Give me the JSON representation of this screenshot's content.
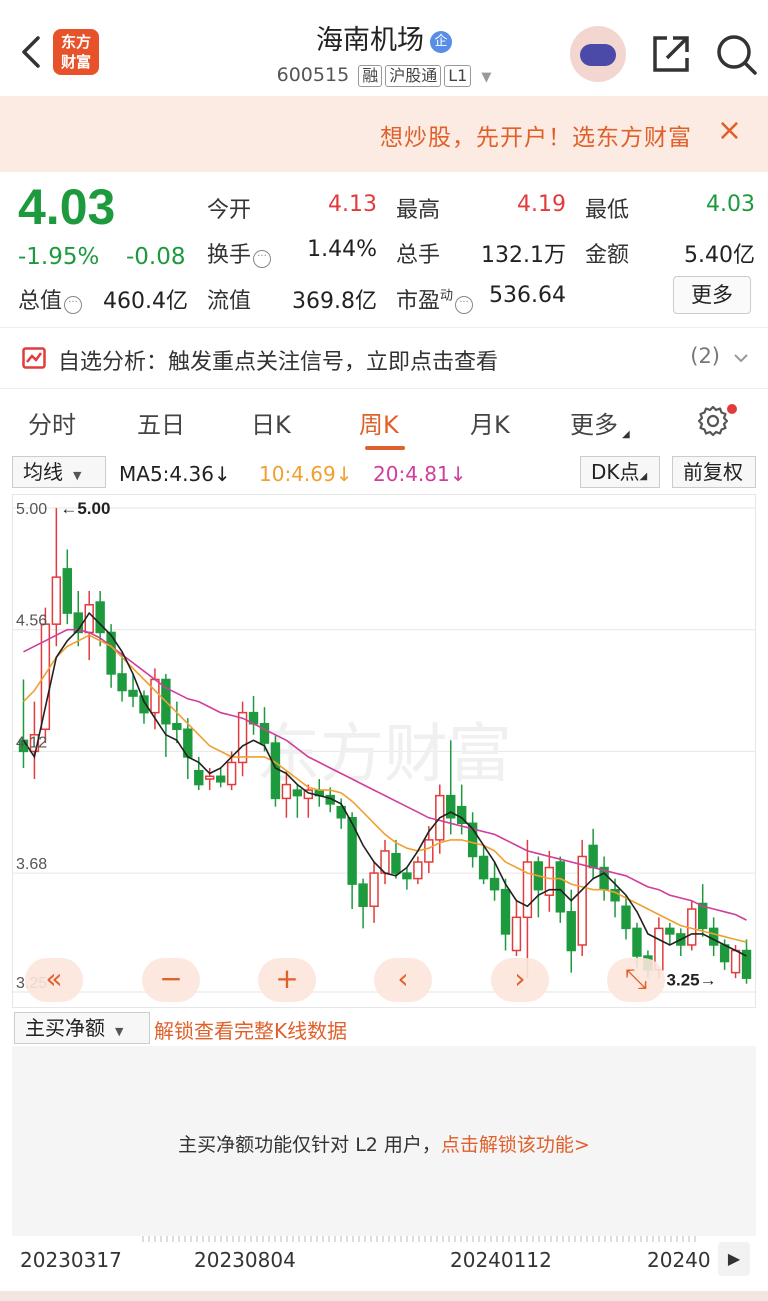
{
  "header": {
    "logo_line1": "东方",
    "logo_line2": "财富",
    "title": "海南机场",
    "title_badge": "企",
    "code": "600515",
    "tags": [
      "融",
      "沪股通",
      "L1"
    ],
    "icons": [
      "back-arrow-icon",
      "robot-avatar-icon",
      "share-icon",
      "search-icon"
    ]
  },
  "promo": {
    "text": "想炒股，先开户！选东方财富",
    "close": "×"
  },
  "quote": {
    "price": "4.03",
    "change_pct": "-1.95%",
    "change": "-0.08",
    "rows": [
      [
        {
          "label": "今开",
          "value": "4.13",
          "color": "#e23b3b"
        },
        {
          "label": "最高",
          "value": "4.19",
          "color": "#e23b3b"
        },
        {
          "label": "最低",
          "value": "4.03",
          "color": "#1e9a3e"
        }
      ],
      [
        {
          "label": "换手",
          "value": "1.44%",
          "color": "#222222"
        },
        {
          "label": "总手",
          "value": "132.1万",
          "color": "#222222"
        },
        {
          "label": "金额",
          "value": "5.40亿",
          "color": "#222222"
        }
      ]
    ],
    "total_value_label": "总值",
    "total_value": "460.4亿",
    "float_value_label": "流值",
    "float_value": "369.8亿",
    "pe_label": "市盈",
    "pe_superscript": "动",
    "pe_value": "536.64",
    "more": "更多"
  },
  "analysis": {
    "text": "自选分析：触发重点关注信号，立即点击查看",
    "count": "(2)"
  },
  "tabs": [
    {
      "label": "分时",
      "active": false
    },
    {
      "label": "五日",
      "active": false
    },
    {
      "label": "日K",
      "active": false
    },
    {
      "label": "周K",
      "active": true
    },
    {
      "label": "月K",
      "active": false
    },
    {
      "label": "更多",
      "active": false
    }
  ],
  "ma_row": {
    "selector": "均线",
    "ma5": "MA5:4.36↓",
    "ma10": "10:4.69↓",
    "ma20": "20:4.81↓",
    "dk": "DK点",
    "adjust": "前复权",
    "colors": {
      "ma5": "#222222",
      "ma10": "#f0a030",
      "ma20": "#d03e9a"
    }
  },
  "chart_data": {
    "type": "candlestick",
    "y_ticks": [
      "5.00",
      "4.56",
      "4.12",
      "3.68",
      "3.25"
    ],
    "ylim": [
      3.25,
      5.0
    ],
    "max_label": "←5.00",
    "min_label": "3.25→",
    "watermark": "东方财富",
    "up_color": "#e23b3b",
    "down_color": "#1e9a3e",
    "candles": [
      [
        4.16,
        4.38,
        4.06,
        4.12
      ],
      [
        4.12,
        4.3,
        4.02,
        4.18
      ],
      [
        4.2,
        4.64,
        4.15,
        4.58
      ],
      [
        4.58,
        5.0,
        4.5,
        4.75
      ],
      [
        4.78,
        4.85,
        4.58,
        4.62
      ],
      [
        4.62,
        4.7,
        4.5,
        4.55
      ],
      [
        4.55,
        4.7,
        4.45,
        4.65
      ],
      [
        4.66,
        4.7,
        4.5,
        4.55
      ],
      [
        4.55,
        4.58,
        4.35,
        4.4
      ],
      [
        4.4,
        4.48,
        4.3,
        4.34
      ],
      [
        4.34,
        4.4,
        4.28,
        4.32
      ],
      [
        4.32,
        4.34,
        4.22,
        4.26
      ],
      [
        4.26,
        4.42,
        4.2,
        4.38
      ],
      [
        4.38,
        4.4,
        4.1,
        4.22
      ],
      [
        4.22,
        4.3,
        4.15,
        4.2
      ],
      [
        4.2,
        4.24,
        4.02,
        4.1
      ],
      [
        4.05,
        4.1,
        3.98,
        4.0
      ],
      [
        4.02,
        4.06,
        3.98,
        4.03
      ],
      [
        4.03,
        4.06,
        3.99,
        4.01
      ],
      [
        4.0,
        4.12,
        3.98,
        4.08
      ],
      [
        4.08,
        4.3,
        4.03,
        4.26
      ],
      [
        4.26,
        4.32,
        4.18,
        4.22
      ],
      [
        4.22,
        4.28,
        4.12,
        4.15
      ],
      [
        4.15,
        4.18,
        3.92,
        3.95
      ],
      [
        3.95,
        4.05,
        3.88,
        4.0
      ],
      [
        3.98,
        4.0,
        3.88,
        3.96
      ],
      [
        3.95,
        4.0,
        3.88,
        3.98
      ],
      [
        3.98,
        4.02,
        3.92,
        3.96
      ],
      [
        3.96,
        3.99,
        3.9,
        3.93
      ],
      [
        3.92,
        3.95,
        3.84,
        3.88
      ],
      [
        3.88,
        3.9,
        3.55,
        3.64
      ],
      [
        3.64,
        3.66,
        3.48,
        3.56
      ],
      [
        3.56,
        3.72,
        3.5,
        3.68
      ],
      [
        3.68,
        3.8,
        3.64,
        3.76
      ],
      [
        3.75,
        3.8,
        3.66,
        3.68
      ],
      [
        3.68,
        3.7,
        3.62,
        3.66
      ],
      [
        3.66,
        3.74,
        3.64,
        3.72
      ],
      [
        3.72,
        3.85,
        3.68,
        3.8
      ],
      [
        3.8,
        4.0,
        3.75,
        3.96
      ],
      [
        3.96,
        4.16,
        3.82,
        3.88
      ],
      [
        3.92,
        4.0,
        3.82,
        3.86
      ],
      [
        3.86,
        3.9,
        3.7,
        3.74
      ],
      [
        3.74,
        3.78,
        3.64,
        3.66
      ],
      [
        3.66,
        3.72,
        3.58,
        3.62
      ],
      [
        3.62,
        3.66,
        3.4,
        3.46
      ],
      [
        3.4,
        3.58,
        3.38,
        3.52
      ],
      [
        3.52,
        3.8,
        3.3,
        3.72
      ],
      [
        3.72,
        3.74,
        3.52,
        3.62
      ],
      [
        3.6,
        3.76,
        3.54,
        3.7
      ],
      [
        3.72,
        3.74,
        3.5,
        3.54
      ],
      [
        3.54,
        3.62,
        3.32,
        3.4
      ],
      [
        3.42,
        3.8,
        3.38,
        3.74
      ],
      [
        3.78,
        3.84,
        3.66,
        3.7
      ],
      [
        3.7,
        3.74,
        3.58,
        3.62
      ],
      [
        3.62,
        3.66,
        3.52,
        3.58
      ],
      [
        3.56,
        3.6,
        3.44,
        3.48
      ],
      [
        3.48,
        3.5,
        3.34,
        3.38
      ],
      [
        3.38,
        3.4,
        3.3,
        3.33
      ],
      [
        3.33,
        3.52,
        3.3,
        3.48
      ],
      [
        3.48,
        3.5,
        3.42,
        3.46
      ],
      [
        3.46,
        3.48,
        3.38,
        3.42
      ],
      [
        3.42,
        3.58,
        3.4,
        3.55
      ],
      [
        3.57,
        3.64,
        3.45,
        3.48
      ],
      [
        3.48,
        3.52,
        3.38,
        3.42
      ],
      [
        3.42,
        3.44,
        3.33,
        3.36
      ],
      [
        3.32,
        3.42,
        3.3,
        3.4
      ],
      [
        3.4,
        3.44,
        3.28,
        3.3
      ]
    ],
    "ma5": [
      4.16,
      4.1,
      4.28,
      4.46,
      4.52,
      4.56,
      4.62,
      4.58,
      4.54,
      4.48,
      4.4,
      4.3,
      4.24,
      4.18,
      4.16,
      4.1,
      4.08,
      4.04,
      4.06,
      4.1,
      4.14,
      4.16,
      4.14,
      4.06,
      4.04,
      4.0,
      3.97,
      3.96,
      3.95,
      3.93,
      3.86,
      3.78,
      3.72,
      3.68,
      3.67,
      3.7,
      3.76,
      3.83,
      3.88,
      3.9,
      3.88,
      3.84,
      3.78,
      3.72,
      3.64,
      3.58,
      3.56,
      3.6,
      3.62,
      3.62,
      3.58,
      3.62,
      3.66,
      3.68,
      3.64,
      3.6,
      3.54,
      3.46,
      3.44,
      3.42,
      3.44,
      3.46,
      3.46,
      3.44,
      3.42,
      3.4,
      3.38
    ],
    "ma10": [
      4.3,
      4.34,
      4.4,
      4.46,
      4.5,
      4.52,
      4.54,
      4.52,
      4.5,
      4.46,
      4.42,
      4.38,
      4.34,
      4.3,
      4.26,
      4.22,
      4.18,
      4.14,
      4.12,
      4.1,
      4.1,
      4.1,
      4.1,
      4.08,
      4.05,
      4.02,
      3.99,
      3.98,
      3.98,
      3.97,
      3.94,
      3.9,
      3.86,
      3.82,
      3.79,
      3.77,
      3.76,
      3.77,
      3.79,
      3.8,
      3.8,
      3.79,
      3.78,
      3.76,
      3.72,
      3.7,
      3.68,
      3.67,
      3.66,
      3.66,
      3.64,
      3.63,
      3.62,
      3.62,
      3.61,
      3.59,
      3.57,
      3.55,
      3.53,
      3.51,
      3.49,
      3.48,
      3.47,
      3.46,
      3.45,
      3.44,
      3.43
    ],
    "ma20": [
      4.48,
      4.5,
      4.52,
      4.54,
      4.56,
      4.56,
      4.55,
      4.53,
      4.5,
      4.47,
      4.44,
      4.41,
      4.38,
      4.35,
      4.33,
      4.31,
      4.3,
      4.28,
      4.26,
      4.25,
      4.24,
      4.22,
      4.2,
      4.18,
      4.16,
      4.13,
      4.1,
      4.08,
      4.06,
      4.04,
      4.02,
      4.0,
      3.98,
      3.96,
      3.94,
      3.92,
      3.9,
      3.88,
      3.87,
      3.86,
      3.85,
      3.84,
      3.83,
      3.82,
      3.8,
      3.78,
      3.76,
      3.75,
      3.74,
      3.73,
      3.72,
      3.71,
      3.7,
      3.69,
      3.68,
      3.67,
      3.65,
      3.63,
      3.62,
      3.6,
      3.59,
      3.58,
      3.56,
      3.55,
      3.54,
      3.53,
      3.51
    ]
  },
  "chart_controls": [
    "«",
    "−",
    "+",
    "‹",
    "›",
    "⤡"
  ],
  "indicator": {
    "selector": "主买净额",
    "unlock_link": "解锁查看完整K线数据",
    "message": "主买净额功能仅针对 L2 用户，",
    "message_link": "点击解锁该功能>"
  },
  "timeline": {
    "dates": [
      "20230317",
      "20230804",
      "20240112",
      "20240"
    ],
    "next": "▶"
  }
}
